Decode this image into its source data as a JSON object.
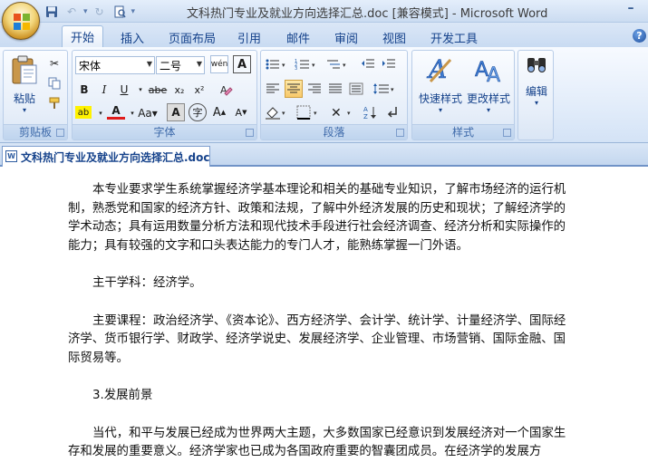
{
  "window": {
    "title": "文科热门专业及就业方向选择汇总.doc [兼容模式] - Microsoft Word"
  },
  "qat": {
    "save_icon": "save-icon",
    "undo_icon": "undo-icon",
    "redo_icon": "redo-icon",
    "preview_icon": "print-preview-icon"
  },
  "tabs": [
    "开始",
    "插入",
    "页面布局",
    "引用",
    "邮件",
    "审阅",
    "视图",
    "开发工具"
  ],
  "ribbon": {
    "clipboard": {
      "label": "剪贴板",
      "paste": "粘贴"
    },
    "font": {
      "label": "字体",
      "font_name": "宋体",
      "font_size": "二号"
    },
    "paragraph": {
      "label": "段落"
    },
    "styles": {
      "label": "样式",
      "quick_styles": "快速样式",
      "change_styles": "更改样式"
    },
    "editing": {
      "label": "编辑"
    }
  },
  "document": {
    "tab_name": "文科热门专业及就业方向选择汇总.doc",
    "paragraphs": [
      "本专业要求学生系统掌握经济学基本理论和相关的基础专业知识，了解市场经济的运行机制，熟悉党和国家的经济方针、政策和法规，了解中外经济发展的历史和现状；了解经济学的学术动态；具有运用数量分析方法和现代技术手段进行社会经济调查、经济分析和实际操作的能力；具有较强的文字和口头表达能力的专门人才，能熟练掌握一门外语。",
      "主干学科：经济学。",
      "主要课程：政治经济学、《资本论》、西方经济学、会计学、统计学、计量经济学、国际经济学、货币银行学、财政学、经济学说史、发展经济学、企业管理、市场营销、国际金融、国际贸易等。",
      "3.发展前景",
      "当代，和平与发展已经成为世界两大主题，大多数国家已经意识到发展经济对一个国家生存和发展的重要意义。经济学家也已成为各国政府重要的智囊团成员。在经济学的发展方"
    ]
  }
}
